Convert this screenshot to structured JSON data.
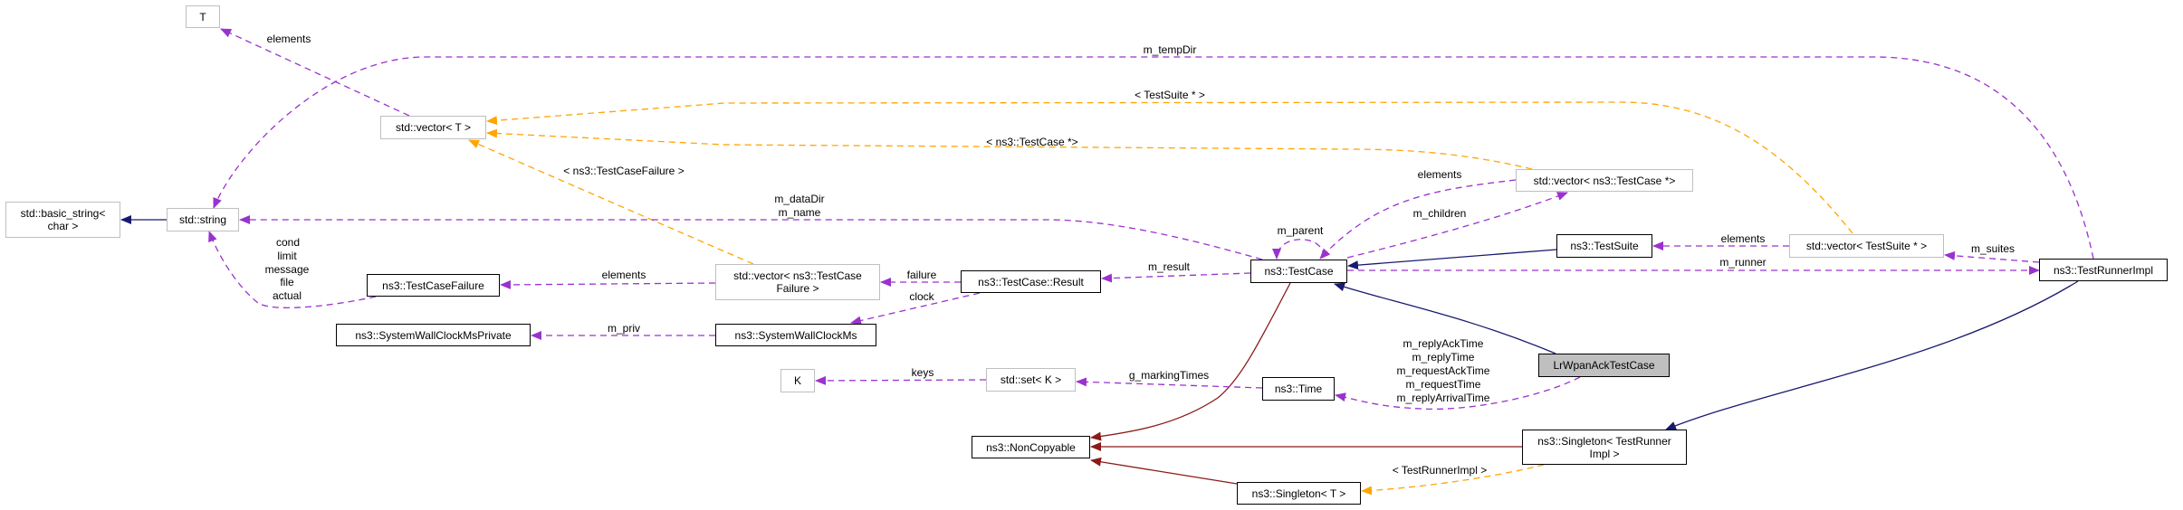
{
  "colors": {
    "usage": "#9a32cd",
    "template": "#ffa500",
    "inheritance": "#191970",
    "private_inheritance": "#8b1a1a",
    "focus_fill": "#bfbfbf"
  },
  "nodes": {
    "T": "T",
    "vector_T": "std::vector< T >",
    "basic_string": "std::basic_string<\nchar >",
    "string": "std::string",
    "testcasefailure": "ns3::TestCaseFailure",
    "swcms_private": "ns3::SystemWallClockMsPrivate",
    "vector_tcf": "std::vector< ns3::TestCase\nFailure >",
    "swcms": "ns3::SystemWallClockMs",
    "result": "ns3::TestCase::Result",
    "testcase": "ns3::TestCase",
    "K": "K",
    "set_K": "std::set< K >",
    "time": "ns3::Time",
    "noncopyable": "ns3::NonCopyable",
    "singleton_T": "ns3::Singleton< T >",
    "vector_testcase": "std::vector< ns3::TestCase *>",
    "testsuite": "ns3::TestSuite",
    "vector_testsuite": "std::vector< TestSuite * >",
    "testrunnerimpl": "ns3::TestRunnerImpl",
    "lrwpan": "LrWpanAckTestCase",
    "singleton_tr": "ns3::Singleton< TestRunner\nImpl >"
  },
  "edge_labels": {
    "elements_T": "elements",
    "m_tempDir": "m_tempDir",
    "tpl_testsuite": "< TestSuite * >",
    "tpl_testcase": "< ns3::TestCase *>",
    "tpl_tcf": "< ns3::TestCaseFailure >",
    "m_dataDir": "m_dataDir",
    "m_name": "m_name",
    "cond": "cond",
    "limit": "limit",
    "message": "message",
    "file": "file",
    "actual": "actual",
    "elements_tcf": "elements",
    "m_priv": "m_priv",
    "failure": "failure",
    "clock": "clock",
    "m_result": "m_result",
    "m_parent": "m_parent",
    "elements_tc": "elements",
    "m_children": "m_children",
    "m_runner": "m_runner",
    "elements_ts": "elements",
    "m_suites": "m_suites",
    "keys": "keys",
    "g_markingTimes": "g_markingTimes",
    "m_replyAckTime": "m_replyAckTime",
    "m_replyTime": "m_replyTime",
    "m_requestAckTime": "m_requestAckTime",
    "m_requestTime": "m_requestTime",
    "m_replyArrivalTime": "m_replyArrivalTime",
    "tpl_testrunnerimpl": "< TestRunnerImpl >"
  }
}
